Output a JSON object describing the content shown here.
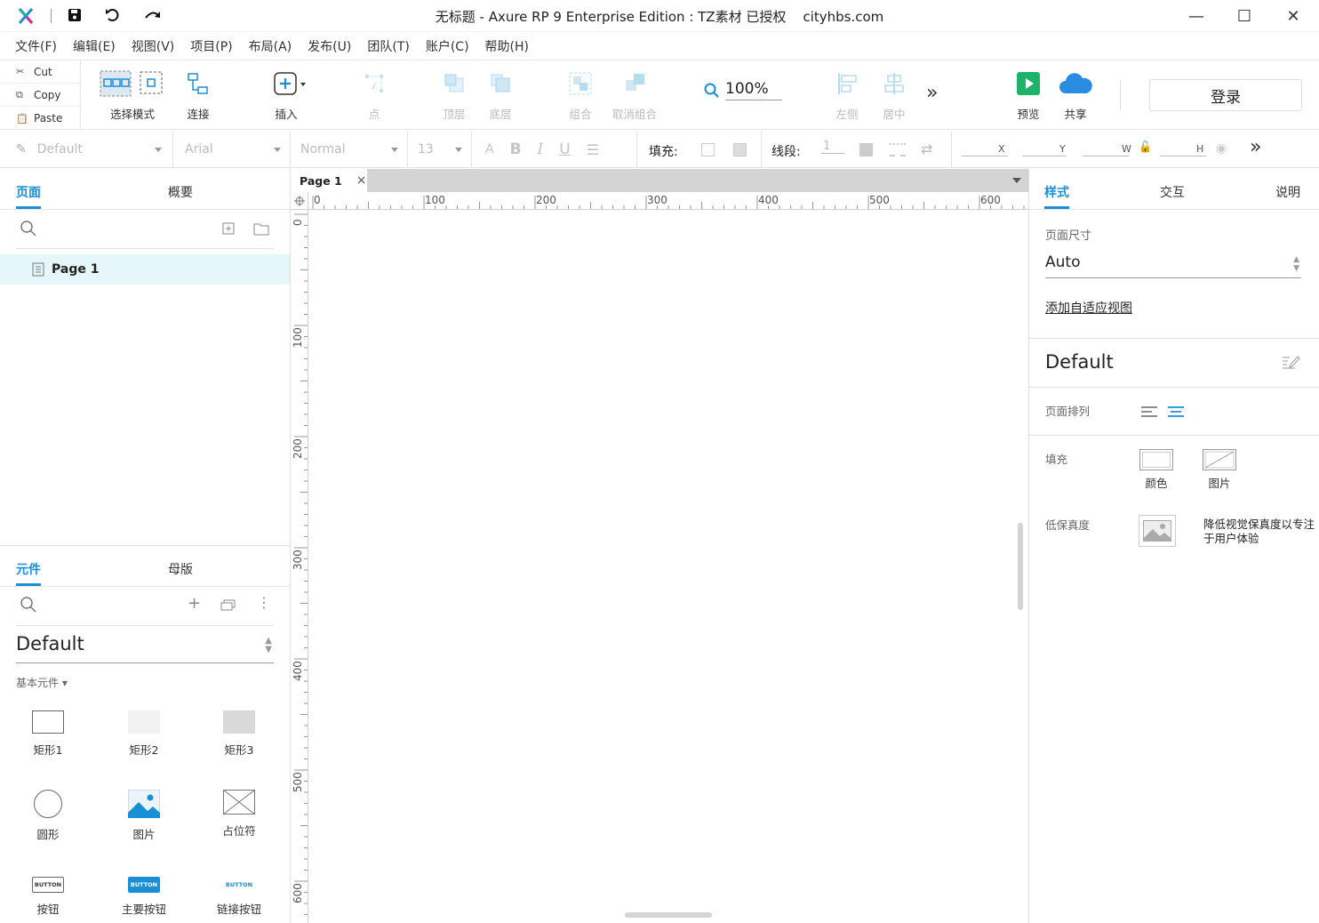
{
  "titlebar": {
    "title": "无标题 - Axure RP 9 Enterprise Edition : TZ素材 已授权    cityhbs.com",
    "logo_icon": "axure-logo-icon",
    "save_icon": "save-icon",
    "undo_icon": "undo-icon",
    "redo_icon": "redo-icon",
    "minimize": "—",
    "maximize": "☐",
    "close": "✕"
  },
  "menu": [
    "文件(F)",
    "编辑(E)",
    "视图(V)",
    "项目(P)",
    "布局(A)",
    "发布(U)",
    "团队(T)",
    "账户(C)",
    "帮助(H)"
  ],
  "clipboard": {
    "cut": "Cut",
    "copy": "Copy",
    "paste": "Paste"
  },
  "toolbar": {
    "select_mode": "选择模式",
    "connect": "连接",
    "insert": "插入",
    "point": "点",
    "top": "顶层",
    "bottom": "底层",
    "group": "组合",
    "ungroup": "取消组合",
    "zoom": "100%",
    "left": "左侧",
    "center": "居中",
    "more": "»",
    "preview": "预览",
    "share": "共享",
    "login": "登录"
  },
  "format": {
    "style": "Default",
    "font": "Arial",
    "weight": "Normal",
    "size": "13",
    "fill_label": "填充:",
    "line_label": "线段:",
    "line_value": "1",
    "x_label": "X",
    "y_label": "Y",
    "w_label": "W",
    "h_label": "H",
    "more": "»"
  },
  "pages_panel": {
    "tab_pages": "页面",
    "tab_outline": "概要",
    "pages": [
      "Page 1"
    ]
  },
  "library_panel": {
    "tab_widgets": "元件",
    "tab_masters": "母版",
    "library": "Default",
    "category": "基本元件 ▾",
    "items": [
      "矩形1",
      "矩形2",
      "矩形3",
      "圆形",
      "图片",
      "占位符",
      "按钮",
      "主要按钮",
      "链接按钮"
    ],
    "button_text": "BUTTON"
  },
  "canvas": {
    "tab": "Page 1",
    "tab_close": "×",
    "hruler": [
      "0",
      "100",
      "200",
      "300",
      "400",
      "500",
      "600"
    ],
    "vruler": [
      "0",
      "100",
      "200",
      "300",
      "400",
      "500",
      "600"
    ]
  },
  "style_panel": {
    "tab_style": "样式",
    "tab_interact": "交互",
    "tab_notes": "说明",
    "page_size_label": "页面尺寸",
    "page_size": "Auto",
    "add_adaptive": "添加自适应视图",
    "style_name": "Default",
    "page_align_label": "页面排列",
    "fill_label": "填充",
    "fill_color": "颜色",
    "fill_image": "图片",
    "low_fi_label": "低保真度",
    "low_fi_desc": "降低视觉保真度以专注于用户体验"
  },
  "colors": {
    "accent": "#1a8fd6",
    "preview_green": "#1db36b",
    "share_blue": "#2b8be0"
  }
}
